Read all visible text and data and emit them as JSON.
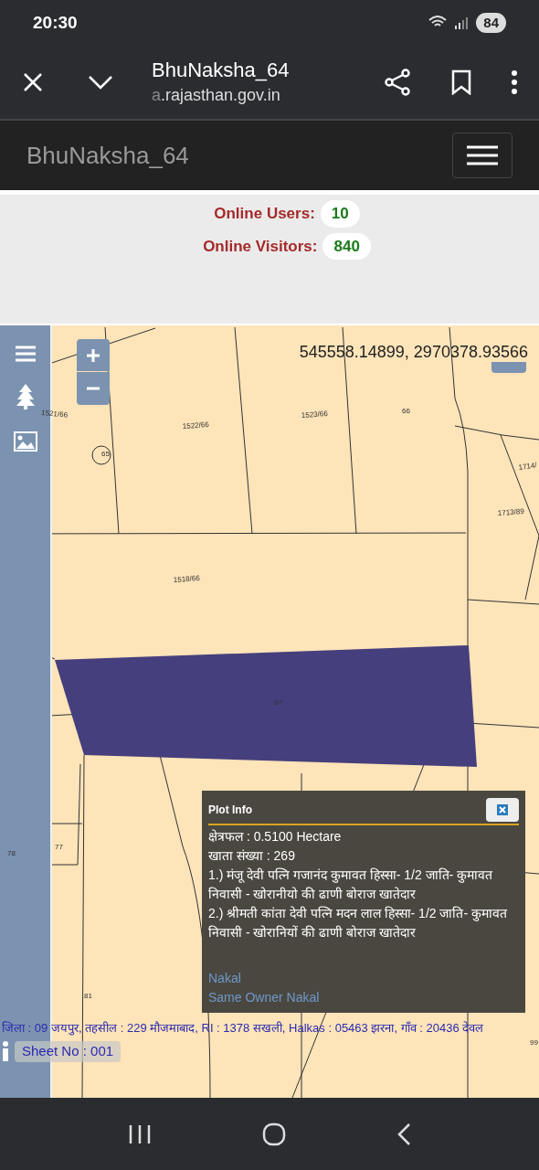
{
  "status_bar": {
    "time": "20:30",
    "battery": "84"
  },
  "browser": {
    "title": "BhuNaksha_64",
    "url_faded": "a",
    "url": ".rajasthan.gov.in"
  },
  "site_header": {
    "title": "BhuNaksha_64"
  },
  "online": [
    {
      "label": "Online Users:",
      "value": "10"
    },
    {
      "label": "Online Visitors:",
      "value": "840"
    }
  ],
  "map": {
    "coordinates": "545558.14899, 2970378.93566",
    "plot_labels": [
      "1521/66",
      "1522/66",
      "1523/66",
      "66",
      "65",
      "1714/",
      "1713/89",
      "1518/66",
      "67",
      "78",
      "77",
      "81",
      "99"
    ],
    "location_line": "जिला : 09 जयपुर, तहसील : 229 मौजमाबाद, RI : 1378 सखली, Halkas : 05463 झरना, गाँव : 20436 देवल",
    "sheet": "Sheet No : 001"
  },
  "plot_info": {
    "title": "Plot Info",
    "lines": [
      "क्षेत्रफल : 0.5100 Hectare",
      "खाता संख्या : 269",
      "1.) मंजू देवी पत्नि गजानंद कुमावत हिस्सा- 1/2 जाति- कुमावत निवासी - खोरानीयो की ढाणी बोराज खातेदार",
      "2.) श्रीमती कांता देवी पत्नि मदन लाल हिस्सा- 1/2 जाति- कुमावत निवासी - खोरानियों की ढाणी बोराज खातेदार"
    ],
    "links": [
      "Nakal",
      "Same Owner Nakal"
    ]
  }
}
